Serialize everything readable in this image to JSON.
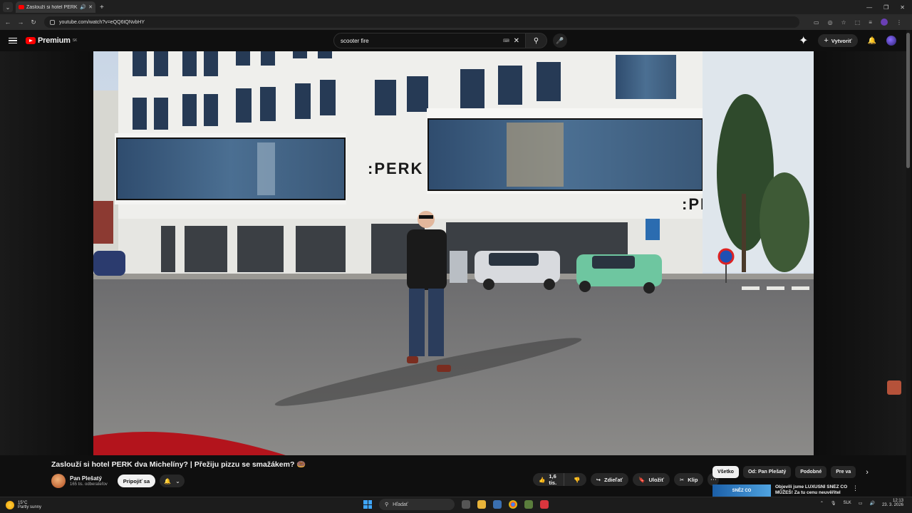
{
  "browser": {
    "tab_title": "Zaslouží si hotel PERK dva M",
    "url": "youtube.com/watch?v=eQQ6tQNvbHY"
  },
  "youtube": {
    "logo_text": "Premium",
    "country_code": "SK",
    "search_value": "scooter fire",
    "create_label": "Vytvoriť"
  },
  "video": {
    "title": "Zaslouží si hotel PERK dva Michelíny? | Přežiju pizzu se smažákem? 🍩",
    "sign_text": ":PERK",
    "channel_name": "Pan Plešatý",
    "subscribers": "165 tis. odberateľov",
    "join_label": "Pripojiť sa",
    "like_count": "1,6 tis.",
    "share_label": "Zdieľať",
    "save_label": "Uložiť",
    "clip_label": "Klip"
  },
  "right_rail": {
    "chips": [
      "Všetko",
      "Od: Pan Plešatý",
      "Podobné",
      "Pre va"
    ],
    "rec_thumb_text": "SNĚZ CO",
    "rec_title": "Objevili jsme LUXUSNÍ SNĚZ CO MŮŽEŠ! Za tu cenu neuvěřitel"
  },
  "taskbar": {
    "temperature": "15°C",
    "weather_desc": "Partly sunny",
    "search_label": "Hľadať",
    "language": "SLK",
    "time": "12:13",
    "date": "23. 3. 2026"
  },
  "colors": {
    "brand_red": "#ff0000",
    "background": "#0f0f0f",
    "chip_bg": "#272727",
    "active_chip": "#f1f1f1"
  }
}
